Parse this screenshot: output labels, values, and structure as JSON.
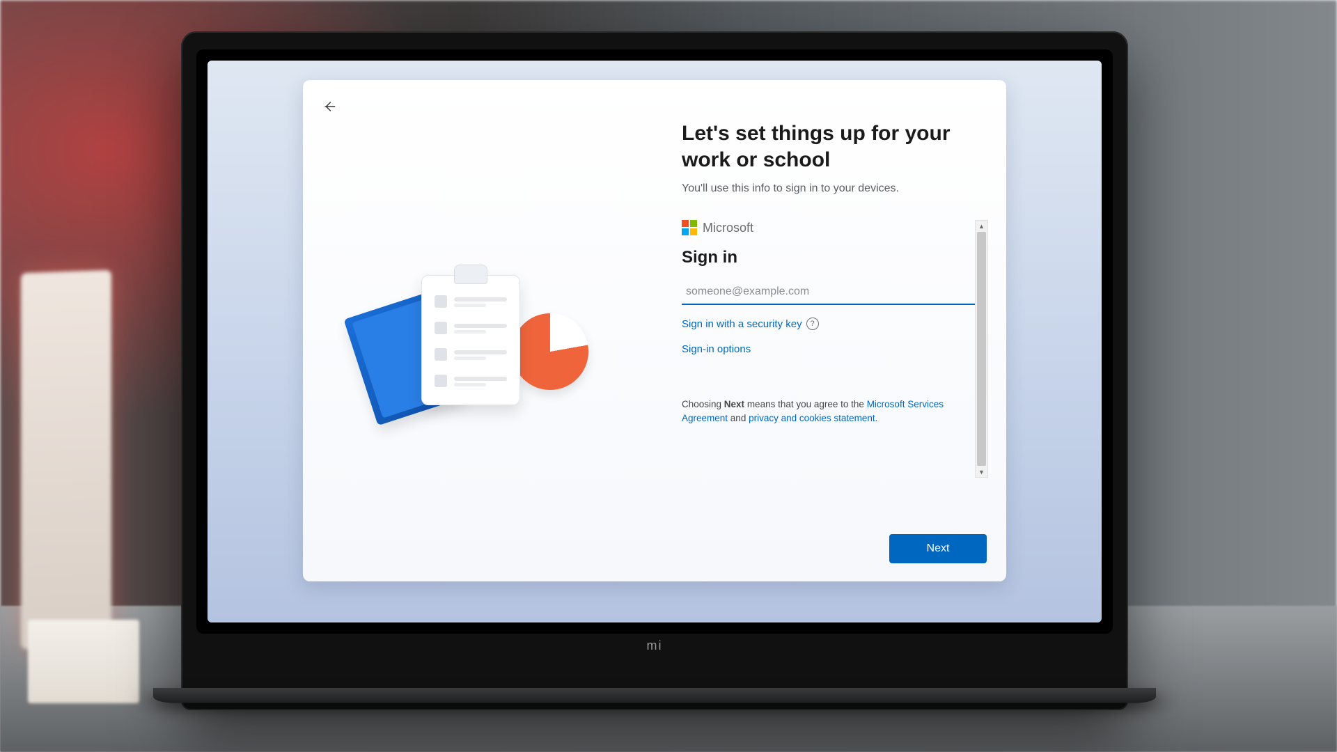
{
  "laptop_brand": "mi",
  "oobe": {
    "title": "Let's set things up for your work or school",
    "subtitle": "You'll use this info to sign in to your devices.",
    "brand_name": "Microsoft",
    "signin_heading": "Sign in",
    "email_placeholder": "someone@example.com",
    "email_value": "",
    "security_key_link": "Sign in with a security key",
    "signin_options_link": "Sign-in options",
    "legal_prefix": "Choosing ",
    "legal_bold": "Next",
    "legal_mid": " means that you agree to the ",
    "legal_services_link": "Microsoft Services Agreement",
    "legal_and": " and ",
    "legal_privacy_link": "privacy and cookies statement",
    "legal_period": ".",
    "next_label": "Next"
  }
}
